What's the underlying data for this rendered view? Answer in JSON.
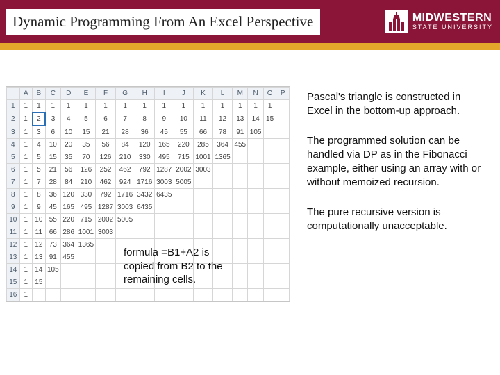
{
  "header": {
    "title": "Dynamic Programming From An Excel Perspective",
    "logo_main": "MIDWESTERN",
    "logo_sub": "STATE UNIVERSITY"
  },
  "spreadsheet": {
    "cols": [
      "A",
      "B",
      "C",
      "D",
      "E",
      "F",
      "G",
      "H",
      "I",
      "J",
      "K",
      "L",
      "M",
      "N",
      "O",
      "P"
    ],
    "rows": [
      [
        "1",
        "1",
        "1",
        "1",
        "1",
        "1",
        "1",
        "1",
        "1",
        "1",
        "1",
        "1",
        "1",
        "1",
        "1",
        "1"
      ],
      [
        "2",
        "1",
        "2",
        "3",
        "4",
        "5",
        "6",
        "7",
        "8",
        "9",
        "10",
        "11",
        "12",
        "13",
        "14",
        "15",
        ""
      ],
      [
        "3",
        "1",
        "3",
        "6",
        "10",
        "15",
        "21",
        "28",
        "36",
        "45",
        "55",
        "66",
        "78",
        "91",
        "105",
        "",
        ""
      ],
      [
        "4",
        "1",
        "4",
        "10",
        "20",
        "35",
        "56",
        "84",
        "120",
        "165",
        "220",
        "285",
        "364",
        "455",
        "",
        "",
        ""
      ],
      [
        "5",
        "1",
        "5",
        "15",
        "35",
        "70",
        "126",
        "210",
        "330",
        "495",
        "715",
        "1001",
        "1365",
        "",
        "",
        "",
        ""
      ],
      [
        "6",
        "1",
        "5",
        "21",
        "56",
        "126",
        "252",
        "462",
        "792",
        "1287",
        "2002",
        "3003",
        "",
        "",
        "",
        "",
        ""
      ],
      [
        "7",
        "1",
        "7",
        "28",
        "84",
        "210",
        "462",
        "924",
        "1716",
        "3003",
        "5005",
        "",
        "",
        "",
        "",
        "",
        ""
      ],
      [
        "8",
        "1",
        "8",
        "36",
        "120",
        "330",
        "792",
        "1716",
        "3432",
        "6435",
        "",
        "",
        "",
        "",
        "",
        "",
        ""
      ],
      [
        "9",
        "1",
        "9",
        "45",
        "165",
        "495",
        "1287",
        "3003",
        "6435",
        "",
        "",
        "",
        "",
        "",
        "",
        "",
        ""
      ],
      [
        "10",
        "1",
        "10",
        "55",
        "220",
        "715",
        "2002",
        "5005",
        "",
        "",
        "",
        "",
        "",
        "",
        "",
        "",
        ""
      ],
      [
        "11",
        "1",
        "11",
        "66",
        "286",
        "1001",
        "3003",
        "",
        "",
        "",
        "",
        "",
        "",
        "",
        "",
        "",
        ""
      ],
      [
        "12",
        "1",
        "12",
        "73",
        "364",
        "1365",
        "",
        "",
        "",
        "",
        "",
        "",
        "",
        "",
        "",
        "",
        ""
      ],
      [
        "13",
        "1",
        "13",
        "91",
        "455",
        "",
        "",
        "",
        "",
        "",
        "",
        "",
        "",
        "",
        "",
        "",
        ""
      ],
      [
        "14",
        "1",
        "14",
        "105",
        "",
        "",
        "",
        "",
        "",
        "",
        "",
        "",
        "",
        "",
        "",
        "",
        ""
      ],
      [
        "15",
        "1",
        "15",
        "",
        "",
        "",
        "",
        "",
        "",
        "",
        "",
        "",
        "",
        "",
        "",
        "",
        ""
      ],
      [
        "16",
        "1",
        "",
        "",
        "",
        "",
        "",
        "",
        "",
        "",
        "",
        "",
        "",
        "",
        "",
        "",
        ""
      ]
    ]
  },
  "callout": {
    "line1": "formula =B1+A2 is",
    "line2": "copied from B2 to the",
    "line3": "remaining cells."
  },
  "right": {
    "p1": "Pascal's triangle is constructed in Excel in the bottom-up approach.",
    "p2": "The programmed solution can be handled via DP as in the Fibonacci example, either using an array with or without memoized recursion.",
    "p3": "The pure recursive version is computationally unacceptable."
  }
}
